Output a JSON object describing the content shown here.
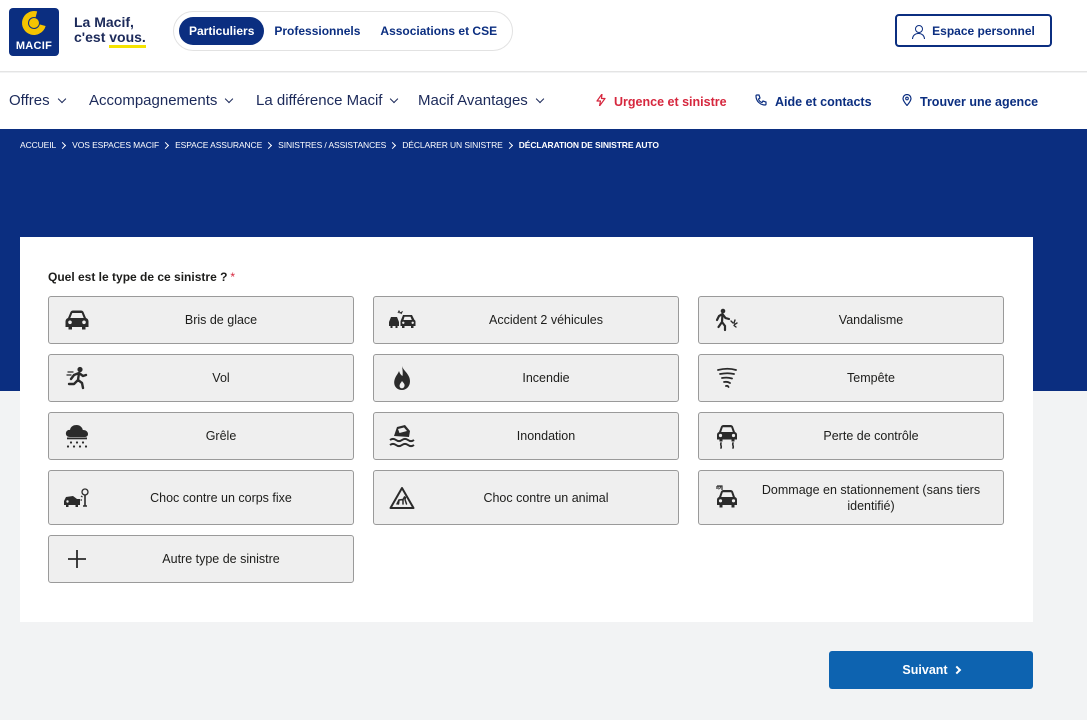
{
  "brand": {
    "logo_text": "MACIF",
    "slogan_line1": "La Macif,",
    "slogan_line2_prefix": "c'est ",
    "slogan_line2_emph": "vous."
  },
  "segments": [
    {
      "label": "Particuliers",
      "active": true
    },
    {
      "label": "Professionnels",
      "active": false
    },
    {
      "label": "Associations et CSE",
      "active": false
    }
  ],
  "espace_personnel": "Espace personnel",
  "nav": {
    "menus": [
      "Offres",
      "Accompagnements",
      "La différence Macif",
      "Macif Avantages"
    ],
    "urgence": "Urgence et sinistre",
    "aide": "Aide et contacts",
    "agence": "Trouver une agence"
  },
  "breadcrumb": [
    "Accueil",
    "Vos espaces Macif",
    "Espace assurance",
    "Sinistres / Assistances",
    "Déclarer un sinistre",
    "Déclaration de sinistre auto"
  ],
  "form": {
    "question": "Quel est le type de ce sinistre ?",
    "required_mark": "*",
    "options": [
      {
        "label": "Bris de glace",
        "icon": "car-front-icon"
      },
      {
        "label": "Accident 2 véhicules",
        "icon": "car-collision-icon"
      },
      {
        "label": "Vandalisme",
        "icon": "vandal-icon"
      },
      {
        "label": "Vol",
        "icon": "thief-running-icon"
      },
      {
        "label": "Incendie",
        "icon": "fire-icon"
      },
      {
        "label": "Tempête",
        "icon": "tornado-icon"
      },
      {
        "label": "Grêle",
        "icon": "hail-cloud-icon"
      },
      {
        "label": "Inondation",
        "icon": "flood-car-icon"
      },
      {
        "label": "Perte de contrôle",
        "icon": "car-skid-icon"
      },
      {
        "label": "Choc contre un corps fixe",
        "icon": "car-crash-tree-icon"
      },
      {
        "label": "Choc contre un animal",
        "icon": "animal-warning-icon"
      },
      {
        "label": "Dommage en stationnement (sans tiers identifié)",
        "icon": "parked-car-icon"
      },
      {
        "label": "Autre type de sinistre",
        "icon": "plus-icon"
      }
    ]
  },
  "next_button": "Suivant",
  "colors": {
    "brand_blue": "#0b2e80",
    "accent_yellow": "#f5c400",
    "urgent_red": "#d6273e",
    "button_blue": "#0d63b0"
  }
}
